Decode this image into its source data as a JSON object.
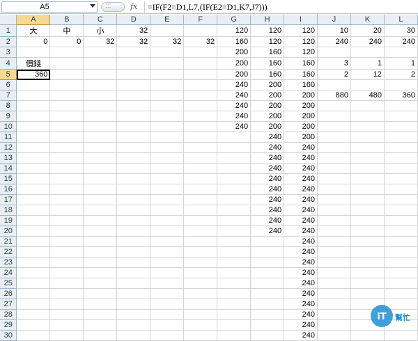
{
  "formula_bar": {
    "name_box": "A5",
    "fx_label": "fx",
    "formula": "=IF(F2=D1,L7,(IF(E2=D1,K7,J7)))"
  },
  "columns": [
    "A",
    "B",
    "C",
    "D",
    "E",
    "F",
    "G",
    "H",
    "I",
    "J",
    "K",
    "L"
  ],
  "selected_column": "A",
  "selected_row": 5,
  "rows": [
    {
      "n": "1",
      "c": [
        "大",
        "中",
        "小",
        "32",
        "",
        "",
        "120",
        "120",
        "120",
        "10",
        "20",
        "30"
      ]
    },
    {
      "n": "2",
      "c": [
        "0",
        "0",
        "32",
        "32",
        "32",
        "32",
        "160",
        "120",
        "120",
        "240",
        "240",
        "240"
      ]
    },
    {
      "n": "3",
      "c": [
        "",
        "",
        "",
        "",
        "",
        "",
        "200",
        "160",
        "120",
        "",
        "",
        ""
      ]
    },
    {
      "n": "4",
      "c": [
        "價錢",
        "",
        "",
        "",
        "",
        "",
        "200",
        "160",
        "160",
        "3",
        "1",
        "1"
      ]
    },
    {
      "n": "5",
      "c": [
        "360",
        "",
        "",
        "",
        "",
        "",
        "200",
        "160",
        "160",
        "2",
        "12",
        "2"
      ]
    },
    {
      "n": "6",
      "c": [
        "",
        "",
        "",
        "",
        "",
        "",
        "240",
        "200",
        "160",
        "",
        "",
        ""
      ]
    },
    {
      "n": "7",
      "c": [
        "",
        "",
        "",
        "",
        "",
        "",
        "240",
        "200",
        "200",
        "880",
        "480",
        "360"
      ]
    },
    {
      "n": "8",
      "c": [
        "",
        "",
        "",
        "",
        "",
        "",
        "240",
        "200",
        "200",
        "",
        "",
        ""
      ]
    },
    {
      "n": "9",
      "c": [
        "",
        "",
        "",
        "",
        "",
        "",
        "240",
        "200",
        "200",
        "",
        "",
        ""
      ]
    },
    {
      "n": "10",
      "c": [
        "",
        "",
        "",
        "",
        "",
        "",
        "240",
        "200",
        "200",
        "",
        "",
        ""
      ]
    },
    {
      "n": "11",
      "c": [
        "",
        "",
        "",
        "",
        "",
        "",
        "",
        "240",
        "200",
        "",
        "",
        ""
      ]
    },
    {
      "n": "12",
      "c": [
        "",
        "",
        "",
        "",
        "",
        "",
        "",
        "240",
        "240",
        "",
        "",
        ""
      ]
    },
    {
      "n": "13",
      "c": [
        "",
        "",
        "",
        "",
        "",
        "",
        "",
        "240",
        "240",
        "",
        "",
        ""
      ]
    },
    {
      "n": "14",
      "c": [
        "",
        "",
        "",
        "",
        "",
        "",
        "",
        "240",
        "240",
        "",
        "",
        ""
      ]
    },
    {
      "n": "15",
      "c": [
        "",
        "",
        "",
        "",
        "",
        "",
        "",
        "240",
        "240",
        "",
        "",
        ""
      ]
    },
    {
      "n": "16",
      "c": [
        "",
        "",
        "",
        "",
        "",
        "",
        "",
        "240",
        "240",
        "",
        "",
        ""
      ]
    },
    {
      "n": "17",
      "c": [
        "",
        "",
        "",
        "",
        "",
        "",
        "",
        "240",
        "240",
        "",
        "",
        ""
      ]
    },
    {
      "n": "18",
      "c": [
        "",
        "",
        "",
        "",
        "",
        "",
        "",
        "240",
        "240",
        "",
        "",
        ""
      ]
    },
    {
      "n": "19",
      "c": [
        "",
        "",
        "",
        "",
        "",
        "",
        "",
        "240",
        "240",
        "",
        "",
        ""
      ]
    },
    {
      "n": "20",
      "c": [
        "",
        "",
        "",
        "",
        "",
        "",
        "",
        "240",
        "240",
        "",
        "",
        ""
      ]
    },
    {
      "n": "21",
      "c": [
        "",
        "",
        "",
        "",
        "",
        "",
        "",
        "",
        "240",
        "",
        "",
        ""
      ]
    },
    {
      "n": "22",
      "c": [
        "",
        "",
        "",
        "",
        "",
        "",
        "",
        "",
        "240",
        "",
        "",
        ""
      ]
    },
    {
      "n": "23",
      "c": [
        "",
        "",
        "",
        "",
        "",
        "",
        "",
        "",
        "240",
        "",
        "",
        ""
      ]
    },
    {
      "n": "24",
      "c": [
        "",
        "",
        "",
        "",
        "",
        "",
        "",
        "",
        "240",
        "",
        "",
        ""
      ]
    },
    {
      "n": "25",
      "c": [
        "",
        "",
        "",
        "",
        "",
        "",
        "",
        "",
        "240",
        "",
        "",
        ""
      ]
    },
    {
      "n": "26",
      "c": [
        "",
        "",
        "",
        "",
        "",
        "",
        "",
        "",
        "240",
        "",
        "",
        ""
      ]
    },
    {
      "n": "27",
      "c": [
        "",
        "",
        "",
        "",
        "",
        "",
        "",
        "",
        "240",
        "",
        "",
        ""
      ]
    },
    {
      "n": "28",
      "c": [
        "",
        "",
        "",
        "",
        "",
        "",
        "",
        "",
        "240",
        "",
        "",
        ""
      ]
    },
    {
      "n": "29",
      "c": [
        "",
        "",
        "",
        "",
        "",
        "",
        "",
        "",
        "240",
        "",
        "",
        ""
      ]
    },
    {
      "n": "30",
      "c": [
        "",
        "",
        "",
        "",
        "",
        "",
        "",
        "",
        "240",
        "",
        "",
        ""
      ]
    }
  ],
  "watermark": {
    "logo": "iT",
    "text": "幫忙",
    "color": "#1e8fd6"
  }
}
